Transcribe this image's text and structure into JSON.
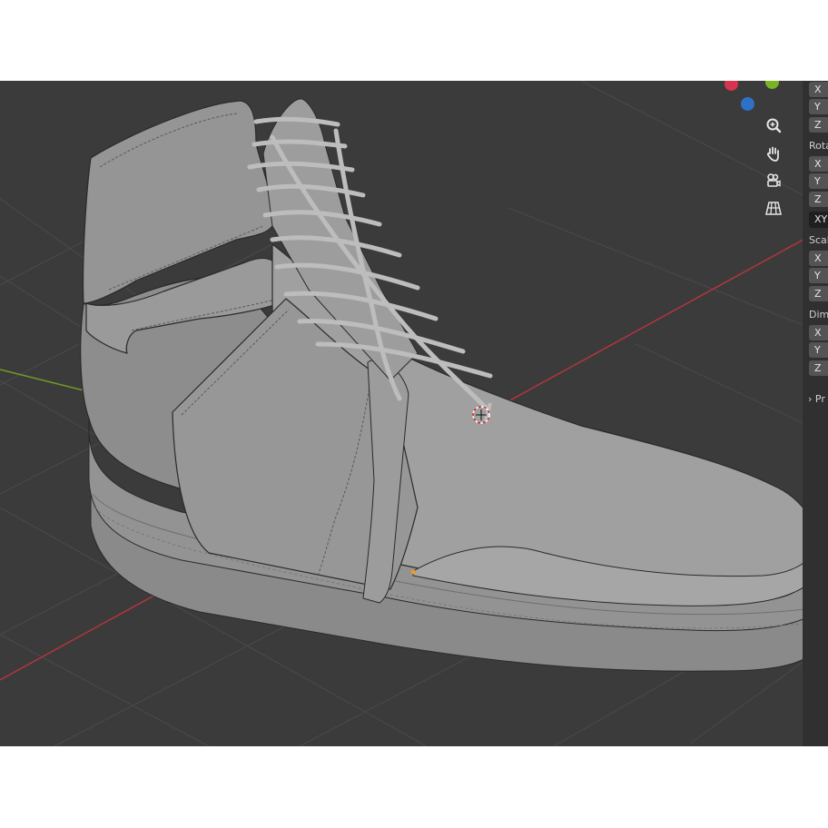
{
  "colors": {
    "viewport_bg": "#3b3b3b",
    "grid_line": "#494949",
    "axis_x": "#b4353f",
    "axis_y": "#6e9a2a",
    "mesh": "#8f8f8f",
    "gizmo_x": "#d9344f",
    "gizmo_y": "#79b522",
    "gizmo_z": "#2f70c9",
    "panel_bg": "#303030",
    "field_bg": "#545454"
  },
  "navigation": {
    "zoom_icon": "zoom-magnifier-icon",
    "pan_icon": "hand-pan-icon",
    "camera_icon": "camera-view-icon",
    "ortho_icon": "perspective-grid-icon"
  },
  "npanel": {
    "location_fields": [
      "X",
      "Y",
      "Z"
    ],
    "rotation_label": "Rota",
    "rotation_fields": [
      "X",
      "Y",
      "Z"
    ],
    "rotation_mode": "XY",
    "scale_label": "Scal",
    "scale_fields": [
      "X",
      "Y",
      "Z"
    ],
    "dimensions_label": "Dim",
    "dimensions_fields": [
      "X",
      "Y",
      "Z"
    ],
    "collapsed_section": "Pr"
  }
}
